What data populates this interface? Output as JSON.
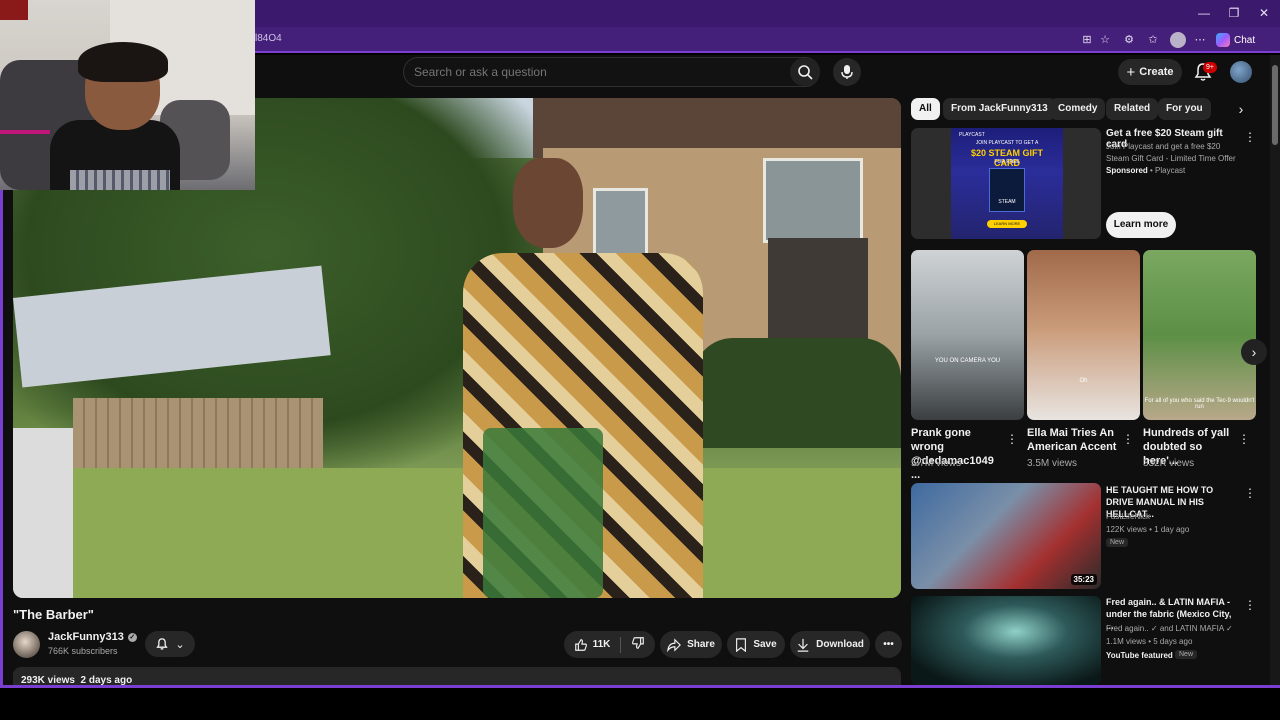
{
  "browser": {
    "address_fragment": "l84O4",
    "chat_label": "Chat"
  },
  "masthead": {
    "search_placeholder": "Search or ask a question",
    "create_label": "Create",
    "notification_count": "9+"
  },
  "video": {
    "title": "\"The Barber\"",
    "channel": "JackFunny313",
    "subscribers": "766K subscribers",
    "likes": "11K",
    "share_label": "Share",
    "save_label": "Save",
    "download_label": "Download",
    "views": "293K views",
    "age": "2 days ago"
  },
  "chips": [
    "All",
    "From JackFunny313",
    "Comedy",
    "Related",
    "For you"
  ],
  "ad": {
    "title": "Get a free $20 Steam gift card",
    "description": "Join Playcast and get a free $20 Steam Gift Card - Limited Time Offer",
    "sponsored_label": "Sponsored",
    "sponsor": "Playcast",
    "cta": "Learn more",
    "card": {
      "brand": "PLAYCAST",
      "top_line": "JOIN PLAYCAST TO GET A",
      "amount": "$20 STEAM GIFT CARD",
      "free": "FOR FREE",
      "logo": "STEAM",
      "button": "LEARN MORE"
    }
  },
  "shorts": [
    {
      "title": "Prank gone wrong @dedamac1049 ...",
      "views": "5.7M views",
      "caption": "YOU ON CAMERA YOU"
    },
    {
      "title": "Ella Mai Tries An American Accent",
      "views": "3.5M views",
      "caption": "Oh"
    },
    {
      "title": "Hundreds of yall doubted so here'...",
      "views": "332K views",
      "caption": "For all of you who said the Tec-9 wouldn't run"
    }
  ],
  "recommendations": [
    {
      "title": "HE TAUGHT ME HOW TO DRIVE MANUAL IN HIS HELLCAT...",
      "channel": "FastLifeNick",
      "stats": "122K views • 1 day ago",
      "badge": "New",
      "duration": "35:23"
    },
    {
      "title": "Fred again.. & LATIN MAFIA - under the fabric (Mexico City, ...",
      "channel": "Fred again.. ✓ and LATIN MAFIA ✓",
      "stats": "1.1M views • 5 days ago",
      "featured": "YouTube featured",
      "badge": "New"
    }
  ],
  "colors": {
    "browser_accent": "#7a3fd0",
    "page_bg": "#0f0f0f",
    "notification_red": "#cc0000"
  }
}
